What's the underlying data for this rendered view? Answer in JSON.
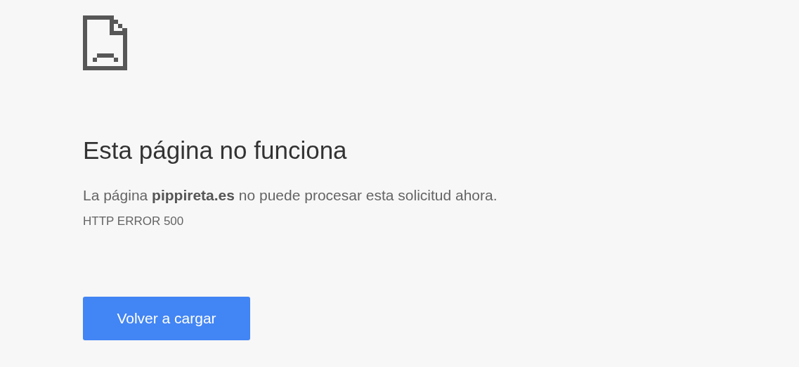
{
  "title": "Esta página no funciona",
  "message": "La página **pippireta.es** no puede procesar esta solicitud ahora.",
  "error_code": "HTTP ERROR 500",
  "button": "Volver a cargar"
}
